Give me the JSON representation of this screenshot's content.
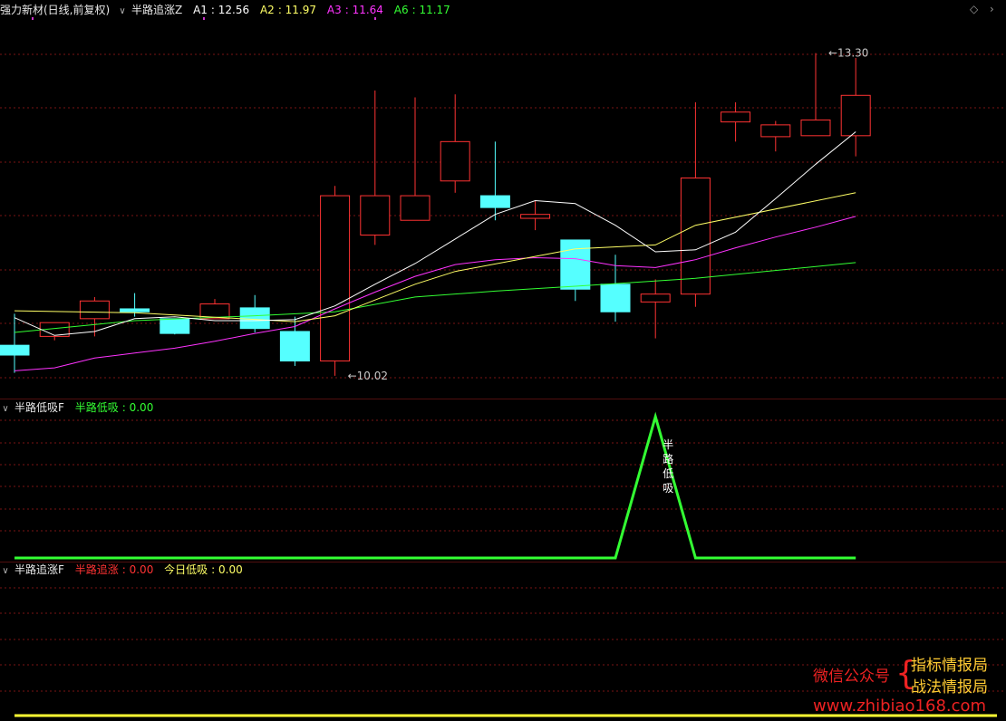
{
  "main_header": {
    "stock": "强力新材(日线,前复权)",
    "indicator": "半路追涨Z",
    "items": [
      {
        "label": "A1",
        "value": "12.56",
        "color": "#ffffff"
      },
      {
        "label": "A2",
        "value": "11.97",
        "color": "#ffff66"
      },
      {
        "label": "A3",
        "value": "11.64",
        "color": "#ff33ff"
      },
      {
        "label": "A6",
        "value": "11.17",
        "color": "#33ff33"
      }
    ]
  },
  "sub1_header": {
    "name": "半路低吸F",
    "items": [
      {
        "label": "半路低吸",
        "value": "0.00",
        "color": "#33ff33"
      }
    ]
  },
  "sub2_header": {
    "name": "半路追涨F",
    "items": [
      {
        "label": "半路追涨",
        "value": "0.00",
        "color": "#ff3333"
      },
      {
        "label": "今日低吸",
        "value": "0.00",
        "color": "#ffff66"
      }
    ]
  },
  "signal_text": "半路低吸",
  "watermark": {
    "left": "微信公众号",
    "right1": "指标情报局",
    "right2": "战法情报局",
    "url": "www.zhibiao168.com"
  },
  "colors": {
    "up": "#ff3333",
    "down": "#55ffff",
    "ma_a1": "#ffffff",
    "ma_a2": "#ffff66",
    "ma_a3": "#ff33ff",
    "ma_a6": "#33ff33",
    "grid": "#7a1515",
    "divider": "#a01c1c",
    "signal": "#33ff33",
    "flat": "#ffff33"
  },
  "chart_data": {
    "type": "candlestick",
    "y_range": [
      10.0,
      13.6
    ],
    "candles": [
      {
        "o": 10.33,
        "h": 10.65,
        "l": 10.05,
        "c": 10.23
      },
      {
        "o": 10.42,
        "h": 10.56,
        "l": 10.38,
        "c": 10.56
      },
      {
        "o": 10.6,
        "h": 10.82,
        "l": 10.42,
        "c": 10.78
      },
      {
        "o": 10.7,
        "h": 10.86,
        "l": 10.62,
        "c": 10.67
      },
      {
        "o": 10.6,
        "h": 10.6,
        "l": 10.44,
        "c": 10.45
      },
      {
        "o": 10.6,
        "h": 10.8,
        "l": 10.6,
        "c": 10.75
      },
      {
        "o": 10.71,
        "h": 10.84,
        "l": 10.46,
        "c": 10.5
      },
      {
        "o": 10.47,
        "h": 10.62,
        "l": 10.12,
        "c": 10.17
      },
      {
        "o": 10.17,
        "h": 11.95,
        "l": 10.02,
        "c": 11.85
      },
      {
        "o": 11.45,
        "h": 12.92,
        "l": 11.35,
        "c": 11.85
      },
      {
        "o": 11.6,
        "h": 12.85,
        "l": 11.6,
        "c": 11.85
      },
      {
        "o": 12.0,
        "h": 12.88,
        "l": 11.88,
        "c": 12.4
      },
      {
        "o": 11.85,
        "h": 12.4,
        "l": 11.6,
        "c": 11.73
      },
      {
        "o": 11.62,
        "h": 11.8,
        "l": 11.5,
        "c": 11.66
      },
      {
        "o": 11.4,
        "h": 11.4,
        "l": 10.78,
        "c": 10.9
      },
      {
        "o": 10.95,
        "h": 11.25,
        "l": 10.57,
        "c": 10.67
      },
      {
        "o": 10.77,
        "h": 11.0,
        "l": 10.4,
        "c": 10.85
      },
      {
        "o": 10.85,
        "h": 12.8,
        "l": 10.72,
        "c": 12.03
      },
      {
        "o": 12.6,
        "h": 12.8,
        "l": 12.4,
        "c": 12.7
      },
      {
        "o": 12.45,
        "h": 12.61,
        "l": 12.3,
        "c": 12.57
      },
      {
        "o": 12.46,
        "h": 13.3,
        "l": 12.46,
        "c": 12.62
      },
      {
        "o": 12.46,
        "h": 13.25,
        "l": 12.25,
        "c": 12.87
      }
    ],
    "ma_a1": [
      [
        0,
        10.61
      ],
      [
        1,
        10.43
      ],
      [
        2,
        10.47
      ],
      [
        3,
        10.6
      ],
      [
        4,
        10.62
      ],
      [
        5,
        10.58
      ],
      [
        6,
        10.58
      ],
      [
        7,
        10.59
      ],
      [
        8,
        10.73
      ],
      [
        9,
        10.95
      ],
      [
        10,
        11.16
      ],
      [
        11,
        11.41
      ],
      [
        12,
        11.66
      ],
      [
        13,
        11.8
      ],
      [
        14,
        11.77
      ],
      [
        15,
        11.55
      ],
      [
        16,
        11.28
      ],
      [
        17,
        11.3
      ],
      [
        18,
        11.48
      ],
      [
        19,
        11.82
      ],
      [
        20,
        12.17
      ],
      [
        21,
        12.5
      ]
    ],
    "ma_a2": [
      [
        0,
        10.68
      ],
      [
        3,
        10.66
      ],
      [
        7,
        10.57
      ],
      [
        8,
        10.63
      ],
      [
        10,
        10.95
      ],
      [
        11,
        11.08
      ],
      [
        14,
        11.31
      ],
      [
        16,
        11.35
      ],
      [
        17,
        11.55
      ],
      [
        21,
        11.88
      ]
    ],
    "ma_a3": [
      [
        0,
        10.07
      ],
      [
        1,
        10.1
      ],
      [
        2,
        10.2
      ],
      [
        3,
        10.25
      ],
      [
        4,
        10.3
      ],
      [
        5,
        10.37
      ],
      [
        6,
        10.45
      ],
      [
        7,
        10.52
      ],
      [
        8,
        10.7
      ],
      [
        9,
        10.87
      ],
      [
        10,
        11.03
      ],
      [
        11,
        11.15
      ],
      [
        12,
        11.2
      ],
      [
        13,
        11.22
      ],
      [
        14,
        11.21
      ],
      [
        15,
        11.14
      ],
      [
        16,
        11.12
      ],
      [
        17,
        11.2
      ],
      [
        18,
        11.32
      ],
      [
        19,
        11.43
      ],
      [
        20,
        11.53
      ],
      [
        21,
        11.64
      ]
    ],
    "ma_a6": [
      [
        0,
        10.46
      ],
      [
        3,
        10.58
      ],
      [
        6,
        10.63
      ],
      [
        8,
        10.67
      ],
      [
        10,
        10.82
      ],
      [
        12,
        10.88
      ],
      [
        14,
        10.93
      ],
      [
        17,
        11.01
      ],
      [
        21,
        11.17
      ]
    ],
    "signal": [
      [
        0,
        0
      ],
      [
        15,
        0
      ],
      [
        16,
        1
      ],
      [
        17,
        0
      ],
      [
        21,
        0
      ]
    ],
    "annotations": [
      {
        "text": "13.30",
        "candle": 20,
        "price": 13.3
      },
      {
        "text": "10.02",
        "candle": 8,
        "price": 10.02
      }
    ]
  }
}
